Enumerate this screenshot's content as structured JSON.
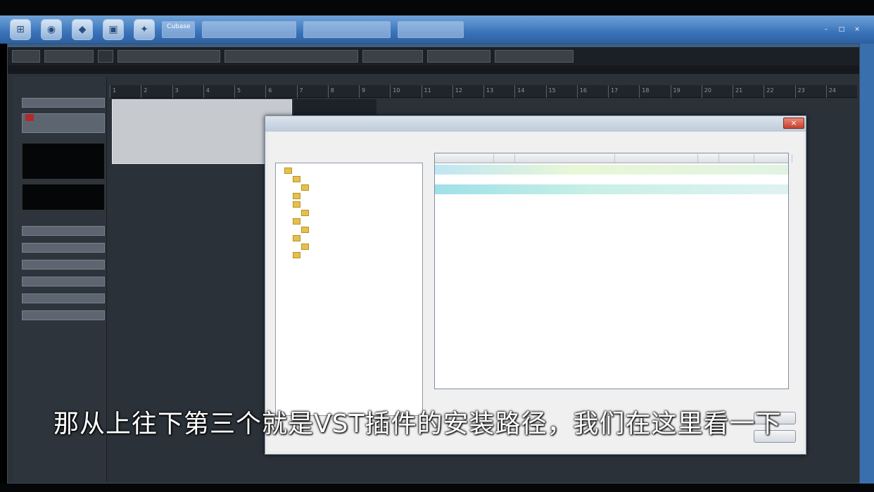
{
  "taskbar": {
    "tasks": [
      "Cubase",
      "",
      "",
      ""
    ],
    "tray": [
      "–",
      "□",
      "×"
    ]
  },
  "toolbar": {
    "items": [
      "",
      "",
      "",
      "",
      "",
      "",
      "",
      ""
    ]
  },
  "inspector": {
    "tab": "",
    "bars": [
      "",
      "",
      "",
      "",
      "",
      "",
      "",
      "",
      ""
    ]
  },
  "ruler": {
    "marks": [
      "1",
      "2",
      "3",
      "4",
      "5",
      "6",
      "7",
      "8",
      "9",
      "10",
      "11",
      "12",
      "13",
      "14",
      "15",
      "16",
      "17",
      "18",
      "19",
      "20",
      "21",
      "22",
      "23",
      "24"
    ]
  },
  "dialog": {
    "title": "",
    "close_label": "×",
    "tree_label": "",
    "list_label": "",
    "tree_items": [
      "",
      "",
      "",
      "",
      "",
      "",
      "",
      "",
      "",
      "",
      ""
    ],
    "columns": [
      "",
      "",
      "",
      "",
      "",
      "",
      ""
    ],
    "rows": [
      {
        "c1": "",
        "c2": "",
        "c3": "",
        "c4": "",
        "c5": "",
        "c6": ""
      },
      {
        "c1": "",
        "c2": "",
        "c3": "",
        "c4": "",
        "c5": "",
        "c6": ""
      },
      {
        "c1": "",
        "c2": "",
        "c3": "",
        "c4": "",
        "c5": "",
        "c6": ""
      }
    ],
    "status": "",
    "ok_label": "",
    "cancel_label": ""
  },
  "subtitle": "那从上往下第三个就是VST插件的安装路径，我们在这里看一下"
}
